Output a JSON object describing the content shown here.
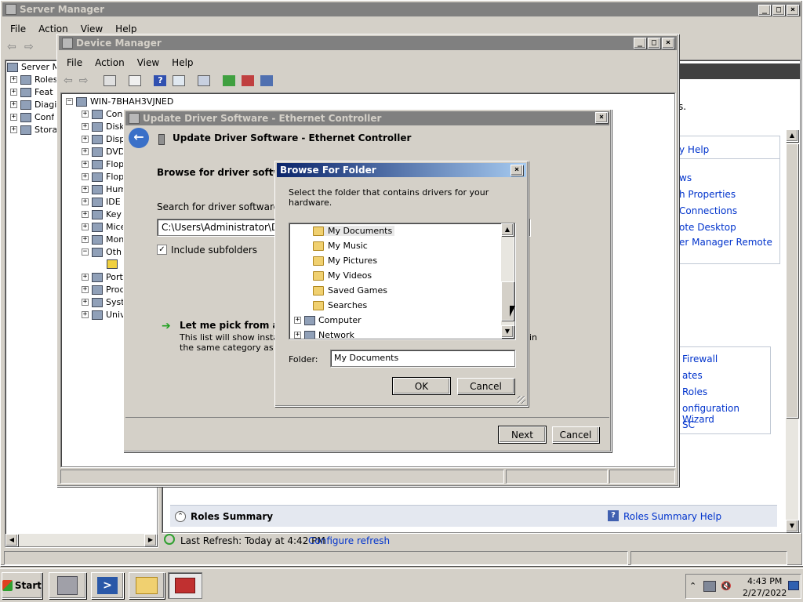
{
  "server_manager": {
    "title": "Server Manager",
    "menu": [
      "File",
      "Action",
      "View",
      "Help"
    ],
    "tree_root": "Server M",
    "tree_items": [
      "Roles",
      "Feat",
      "Diagi",
      "Conf",
      "Stora"
    ],
    "right_link_text": "s.",
    "help_links": [
      "y Help",
      "ws",
      "h Properties",
      "Connections",
      "ote Desktop",
      "er Manager Remote"
    ],
    "help_links2": [
      "Firewall",
      "ates",
      "Roles",
      "onfiguration Wizard",
      "SC"
    ],
    "roles_summary": "Roles Summary",
    "roles_summary_help": "Roles Summary Help",
    "last_refresh": "Last Refresh: Today at 4:42 PM",
    "configure_refresh": "Configure refresh"
  },
  "device_manager": {
    "title": "Device Manager",
    "menu": [
      "File",
      "Action",
      "View",
      "Help"
    ],
    "computer_name": "WIN-7BHAH3VJNED",
    "devices": [
      "Con",
      "Disk",
      "Disp",
      "DVD",
      "Flop",
      "Flop",
      "Hum",
      "IDE",
      "Key",
      "Mice",
      "Mon",
      "Oth",
      "",
      "Port",
      "Proc",
      "Syst",
      "Univ"
    ]
  },
  "update_driver": {
    "title": "Update Driver Software - Ethernet Controller",
    "header": "Update Driver Software - Ethernet Controller",
    "browse_heading": "Browse for driver software",
    "search_label": "Search for driver software in",
    "path_value": "C:\\Users\\Administrator\\Doc",
    "include_subfolders": "Include subfolders",
    "pick_heading": "Let me pick from a lis",
    "pick_desc1": "This list will show installed",
    "pick_desc2": "the same category as the",
    "pick_tail": "in",
    "next": "Next",
    "cancel": "Cancel"
  },
  "browse_folder": {
    "title": "Browse For Folder",
    "instruction": "Select the folder that contains drivers for your hardware.",
    "items": [
      "My Documents",
      "My Music",
      "My Pictures",
      "My Videos",
      "Saved Games",
      "Searches",
      "Computer",
      "Network"
    ],
    "folder_label": "Folder:",
    "folder_value": "My Documents",
    "ok": "OK",
    "cancel": "Cancel"
  },
  "taskbar": {
    "start": "Start",
    "time": "4:43 PM",
    "date": "2/27/2022"
  }
}
